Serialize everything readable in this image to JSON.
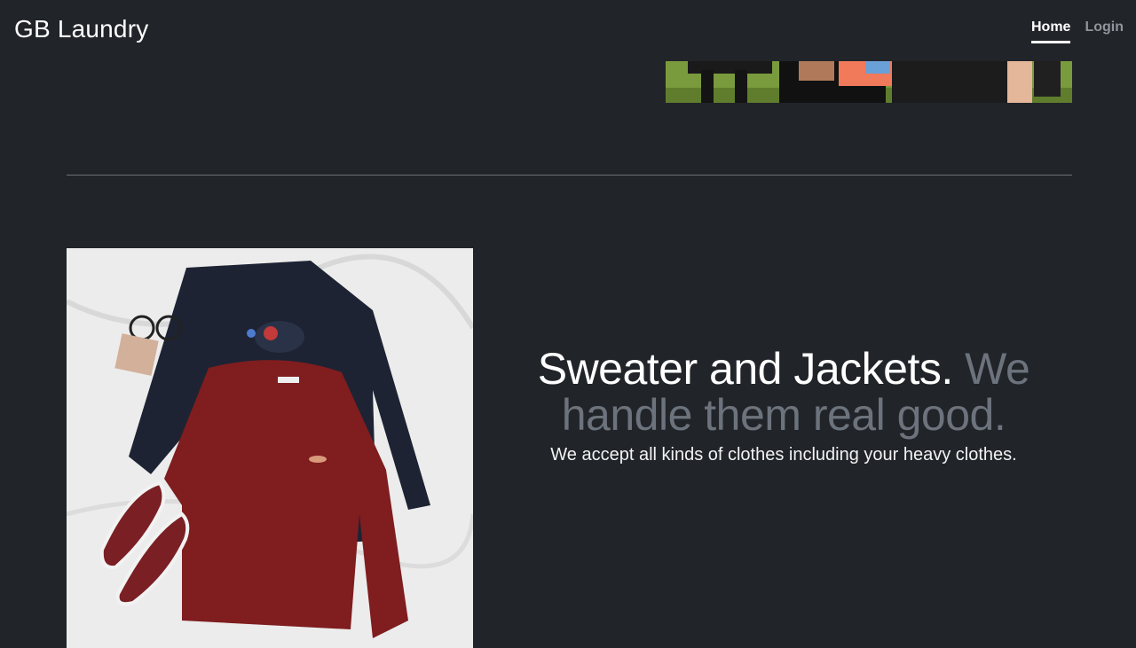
{
  "navbar": {
    "brand": "GB Laundry",
    "links": [
      {
        "label": "Home",
        "active": true
      },
      {
        "label": "Login",
        "active": false
      }
    ]
  },
  "feature": {
    "heading_main": "Sweater and Jackets.",
    "heading_muted": "We handle them real good.",
    "lead": "We accept all kinds of clothes including your heavy clothes."
  },
  "colors": {
    "background": "#212429",
    "muted_text": "#6c737c",
    "divider": "#6d7177"
  }
}
